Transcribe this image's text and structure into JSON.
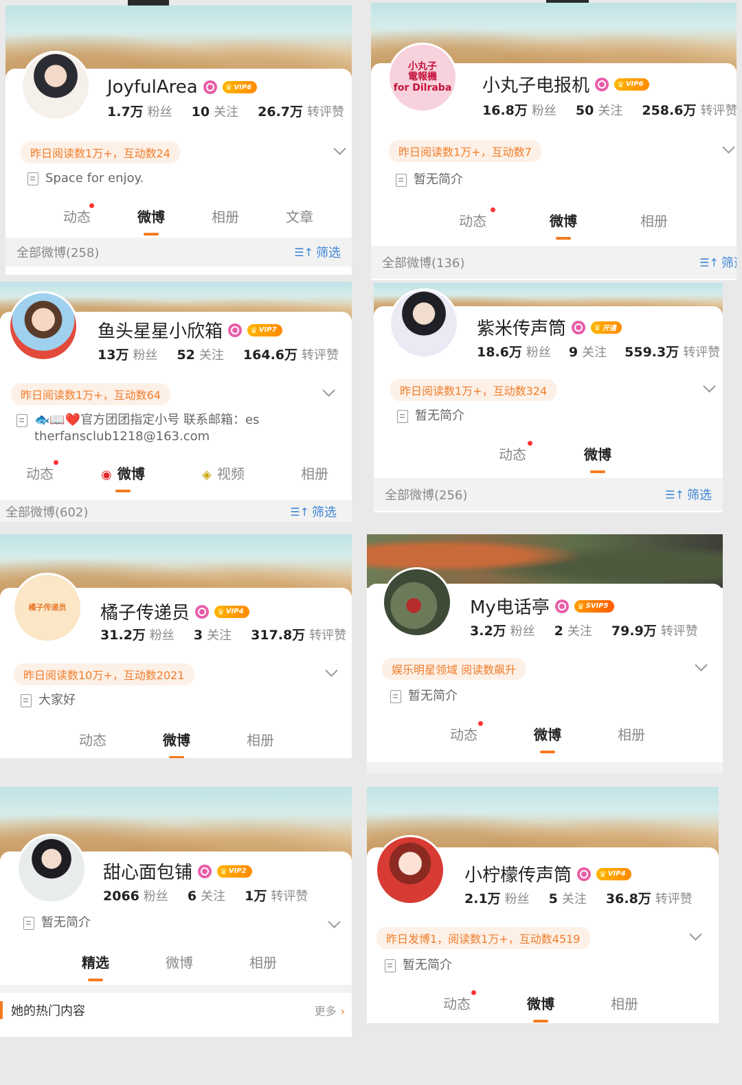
{
  "cards": [
    {
      "name": "JoyfulArea",
      "vip": "VIP6",
      "stats": {
        "fans": "1.7万",
        "fans_label": "粉丝",
        "follow": "10",
        "follow_label": "关注",
        "likes": "26.7万",
        "likes_label": "转评赞"
      },
      "tag": "昨日阅读数1万+，互动数24",
      "bio": "Space for enjoy.",
      "tabs": [
        "动态",
        "微博",
        "相册",
        "文章"
      ],
      "filter": {
        "label": "全部微博(258)",
        "button": "筛选"
      }
    },
    {
      "name": "小丸子电报机",
      "vip": "VIP6",
      "avatar_text": "小丸子\n電報機\nfor Dilraba",
      "stats": {
        "fans": "16.8万",
        "fans_label": "粉丝",
        "follow": "50",
        "follow_label": "关注",
        "likes": "258.6万",
        "likes_label": "转评赞"
      },
      "tag": "昨日阅读数1万+，互动数7",
      "bio": "暂无简介",
      "tabs": [
        "动态",
        "微博",
        "相册"
      ],
      "filter": {
        "label": "全部微博(136)",
        "button": "筛选"
      }
    },
    {
      "name": "鱼头星星小欣箱",
      "vip": "VIP7",
      "stats": {
        "fans": "13万",
        "fans_label": "粉丝",
        "follow": "52",
        "follow_label": "关注",
        "likes": "164.6万",
        "likes_label": "转评赞"
      },
      "tag": "昨日阅读数1万+，互动数64",
      "bio": "🐟📖❤️官方团团指定小号 联系邮箱：estherfansclub1218@163.com",
      "tabs": [
        "动态",
        "微博",
        "视频",
        "相册"
      ],
      "filter": {
        "label": "全部微博(602)",
        "button": "筛选"
      }
    },
    {
      "name": "紫米传声筒",
      "vip": "开通",
      "stats": {
        "fans": "18.6万",
        "fans_label": "粉丝",
        "follow": "9",
        "follow_label": "关注",
        "likes": "559.3万",
        "likes_label": "转评赞"
      },
      "tag": "昨日阅读数1万+，互动数324",
      "bio": "暂无简介",
      "tabs": [
        "动态",
        "微博"
      ],
      "filter": {
        "label": "全部微博(256)",
        "button": "筛选"
      }
    },
    {
      "name": "橘子传递员",
      "vip": "VIP4",
      "avatar_text": "橘子传递员",
      "stats": {
        "fans": "31.2万",
        "fans_label": "粉丝",
        "follow": "3",
        "follow_label": "关注",
        "likes": "317.8万",
        "likes_label": "转评赞"
      },
      "tag": "昨日阅读数10万+，互动数2021",
      "bio": "大家好",
      "tabs": [
        "动态",
        "微博",
        "相册"
      ]
    },
    {
      "name": "My电话亭",
      "vip": "SVIP5",
      "stats": {
        "fans": "3.2万",
        "fans_label": "粉丝",
        "follow": "2",
        "follow_label": "关注",
        "likes": "79.9万",
        "likes_label": "转评赞"
      },
      "tag": "娱乐明星领域 阅读数飙升",
      "bio": "暂无简介",
      "tabs": [
        "动态",
        "微博",
        "相册"
      ]
    },
    {
      "name": "甜心面包铺",
      "vip": "VIP2",
      "stats": {
        "fans": "2066",
        "fans_label": "粉丝",
        "follow": "6",
        "follow_label": "关注",
        "likes": "1万",
        "likes_label": "转评赞"
      },
      "bio": "暂无简介",
      "tabs": [
        "精选",
        "微博",
        "相册"
      ],
      "hot": {
        "title": "她的热门内容",
        "more": "更多"
      }
    },
    {
      "name": "小柠檬传声筒",
      "vip": "VIP4",
      "stats": {
        "fans": "2.1万",
        "fans_label": "粉丝",
        "follow": "5",
        "follow_label": "关注",
        "likes": "36.8万",
        "likes_label": "转评赞"
      },
      "tag": "昨日发博1，阅读数1万+，互动数4519",
      "bio": "暂无简介",
      "tabs": [
        "动态",
        "微博",
        "相册"
      ]
    }
  ],
  "colors": {
    "accent": "#f57a1e",
    "tag_text": "#f07d2c",
    "tag_bg": "#fdf0e6",
    "link": "#3c86d6",
    "verified": "#e85ea8"
  }
}
